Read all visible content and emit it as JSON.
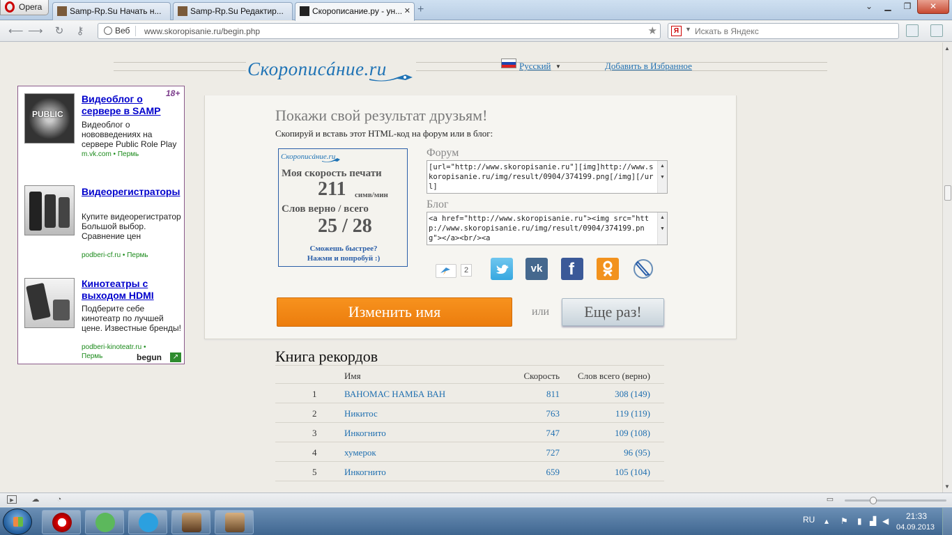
{
  "browser": {
    "menu_label": "Opera",
    "tabs": [
      {
        "label": "Samp-Rp.Su Начать н..."
      },
      {
        "label": "Samp-Rp.Su Редактир..."
      },
      {
        "label": "Скорописание.ру - ун..."
      }
    ],
    "address": {
      "badge": "Веб",
      "url": "www.skoropisanie.ru/begin.php"
    },
    "search": {
      "placeholder": "Искать в Яндекс",
      "engine_icon": "Я"
    },
    "window_controls": [
      "minimize-icon",
      "restore-icon",
      "close-icon"
    ]
  },
  "site": {
    "logo": "Скорописáние.ru",
    "language": "Русский",
    "favorites_link": "Добавить в Избранное"
  },
  "ads": {
    "age_badge": "18+",
    "items": [
      {
        "title": "Видеоблог о сервере в SAMP",
        "desc": "Видеоблог о нововведениях на сервере Public Role Play",
        "url": "m.vk.com",
        "city": "Пермь"
      },
      {
        "title": "Видеорегистраторы",
        "desc": "Купите видеорегистратор Большой выбор. Сравнение цен",
        "url": "podberi-cf.ru",
        "city": "Пермь"
      },
      {
        "title": "Кинотеатры с выходом HDMI",
        "desc": "Подберите себе кинотеатр по лучшей цене. Известные бренды!",
        "url": "podberi-kinoteatr.ru",
        "city": "Пермь"
      }
    ],
    "network": "begun"
  },
  "share": {
    "title": "Покажи свой результат друзьям!",
    "subtitle": "Скопируй и вставь этот HTML-код на форум или в блог:",
    "result_card": {
      "logo": "Скорописáние.ru",
      "speed_label": "Моя скорость печати",
      "speed_value": "211",
      "speed_unit": "симв/мин",
      "words_label": "Слов верно / всего",
      "words_value": "25 / 28",
      "cta_line1": "Сможешь быстрее?",
      "cta_line2": "Нажми и попробуй :)"
    },
    "forum_label": "Форум",
    "forum_code": "[url=\"http://www.skoropisanie.ru\"][img]http://www.skoropisanie.ru/img/result/0904/374199.png[/img][/url]",
    "blog_label": "Блог",
    "blog_code": "<a href=\"http://www.skoropisanie.ru\"><img src=\"http://www.skoropisanie.ru/img/result/0904/374199.png\"></a><br/><a",
    "share_count": "2",
    "social_icons": [
      "share-icon",
      "twitter-icon",
      "vk-icon",
      "facebook-icon",
      "odnoklassniki-icon",
      "livejournal-icon"
    ],
    "colors": {
      "twitter": "#4ab3e6",
      "vk": "#45688e",
      "facebook": "#3b5998",
      "odnoklassniki": "#f2921d"
    }
  },
  "actions": {
    "rename_label": "Изменить имя",
    "or_label": "или",
    "again_label": "Еще раз!"
  },
  "records": {
    "title": "Книга рекордов",
    "headers": {
      "name": "Имя",
      "speed": "Скорость",
      "words": "Слов всего (верно)"
    },
    "rows": [
      {
        "rank": "1",
        "name": "ВАНОМАС НАМБА ВАН",
        "speed": "811",
        "words": "308 (149)"
      },
      {
        "rank": "2",
        "name": "Никитос",
        "speed": "763",
        "words": "119 (119)"
      },
      {
        "rank": "3",
        "name": "Инкогнито",
        "speed": "747",
        "words": "109 (108)"
      },
      {
        "rank": "4",
        "name": "хумерок",
        "speed": "727",
        "words": "96 (95)"
      },
      {
        "rank": "5",
        "name": "Инкогнито",
        "speed": "659",
        "words": "105 (104)"
      }
    ]
  },
  "taskbar": {
    "apps": [
      "opera-icon",
      "utorrent-icon",
      "skype-icon",
      "samp-icon",
      "samp2-icon"
    ],
    "lang": "RU",
    "time": "21:33",
    "date": "04.09.2013"
  }
}
